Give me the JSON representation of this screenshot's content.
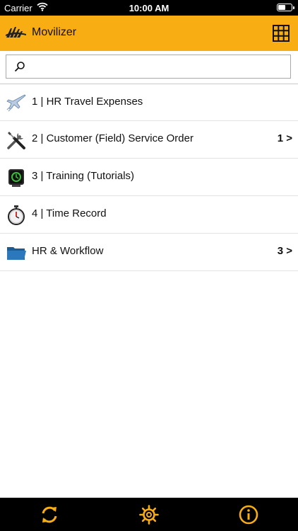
{
  "status_bar": {
    "carrier": "Carrier",
    "time": "10:00 AM"
  },
  "header": {
    "title": "Movilizer",
    "accent_color": "#f8ad12"
  },
  "search": {
    "value": "",
    "placeholder": ""
  },
  "items": [
    {
      "label": "1 | HR Travel Expenses",
      "icon": "airplane-icon",
      "count": ""
    },
    {
      "label": "2 | Customer (Field) Service Order",
      "icon": "wrench-screwdriver-icon",
      "count": "1 >"
    },
    {
      "label": "3 | Training (Tutorials)",
      "icon": "training-device-icon",
      "count": ""
    },
    {
      "label": "4 | Time Record",
      "icon": "stopwatch-icon",
      "count": ""
    },
    {
      "label": "HR & Workflow",
      "icon": "folder-icon",
      "count": "3 >"
    }
  ],
  "toolbar": {
    "icons": [
      "sync-icon",
      "settings-gear-icon",
      "info-icon"
    ],
    "icon_color": "#f8ad12"
  }
}
